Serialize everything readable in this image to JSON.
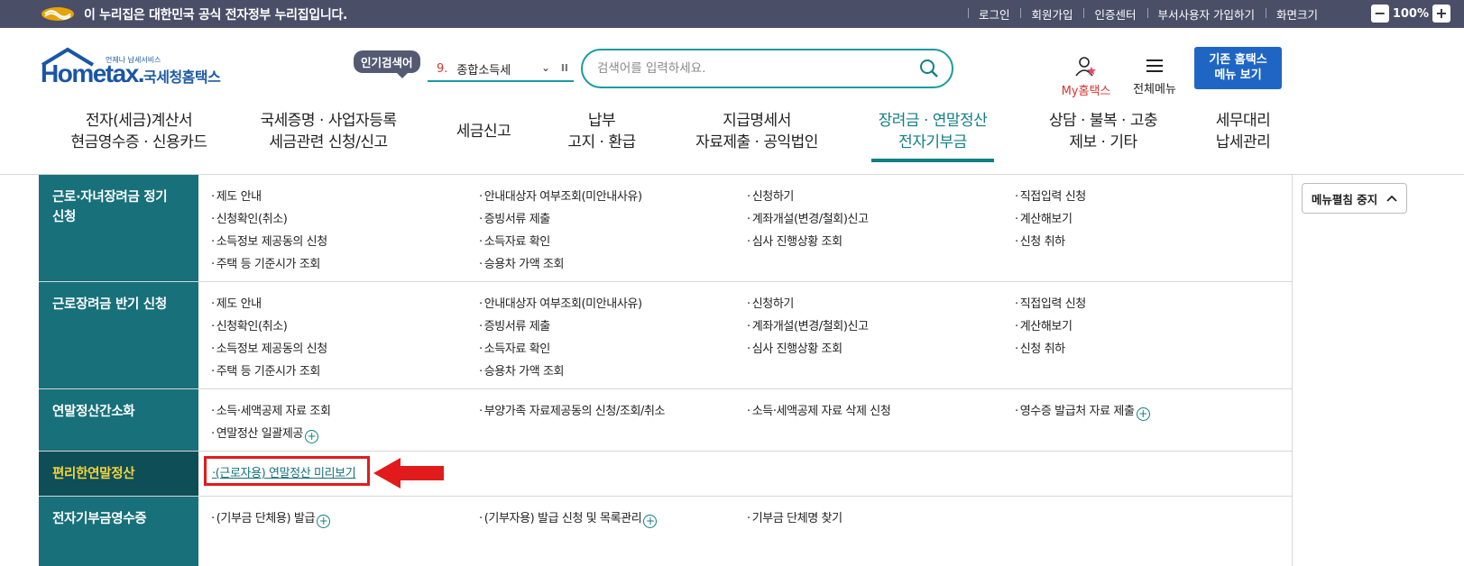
{
  "gov_bar": {
    "text": "이 누리집은 대한민국 공식 전자정부 누리집입니다.",
    "util_links": [
      "로그인",
      "회원가입",
      "인증센터",
      "부서사용자 가입하기",
      "화면크기"
    ],
    "zoom_minus": "−",
    "zoom_level": "100%",
    "zoom_plus": "+"
  },
  "header": {
    "logo_sub": "언제나 납세서비스",
    "logo_text": "Hometax.",
    "logo_kor": "국세청홈택스",
    "popular_label": "인기검색어",
    "popular_rank": "9.",
    "popular_term": "종합소득세",
    "search_placeholder": "검색어를 입력하세요.",
    "my_hometax": "My홈택스",
    "all_menu": "전체메뉴",
    "old_hometax_line1": "기존 홈택스",
    "old_hometax_line2": "메뉴 보기"
  },
  "gnb": [
    {
      "line1": "전자(세금)계산서",
      "line2": "현금영수증 · 신용카드"
    },
    {
      "line1": "국세증명 · 사업자등록",
      "line2": "세금관련 신청/신고"
    },
    {
      "line1": "세금신고",
      "line2": ""
    },
    {
      "line1": "납부",
      "line2": "고지 · 환급"
    },
    {
      "line1": "지급명세서",
      "line2": "자료제출 · 공익법인"
    },
    {
      "line1": "장려금 · 연말정산",
      "line2": "전자기부금"
    },
    {
      "line1": "상담 · 불복 · 고충",
      "line2": "제보 · 기타"
    },
    {
      "line1": "세무대리",
      "line2": "납세관리"
    }
  ],
  "menu_fold": "메뉴펼침 중지",
  "sections": [
    {
      "category_line1": "근로·자녀장려금 정기",
      "category_line2": "신청",
      "links": [
        "제도 안내",
        "안내대상자 여부조회(미안내사유)",
        "신청하기",
        "직접입력 신청",
        "신청확인(취소)",
        "증빙서류 제출",
        "계좌개설(변경/철회)신고",
        "계산해보기",
        "소득정보 제공동의 신청",
        "소득자료 확인",
        "심사 진행상황 조회",
        "신청 취하",
        "주택 등 기준시가 조회",
        "승용차 가액 조회"
      ]
    },
    {
      "category_line1": "근로장려금 반기 신청",
      "category_line2": "",
      "links": [
        "제도 안내",
        "안내대상자 여부조회(미안내사유)",
        "신청하기",
        "직접입력 신청",
        "신청확인(취소)",
        "증빙서류 제출",
        "계좌개설(변경/철회)신고",
        "계산해보기",
        "소득정보 제공동의 신청",
        "소득자료 확인",
        "심사 진행상황 조회",
        "신청 취하",
        "주택 등 기준시가 조회",
        "승용차 가액 조회"
      ]
    },
    {
      "category_line1": "연말정산간소화",
      "category_line2": "",
      "links": [
        "소득·세액공제 자료 조회",
        "부양가족 자료제공동의 신청/조회/취소",
        "소득·세액공제 자료 삭제 신청",
        "영수증 발급처 자료 제출",
        "연말정산 일괄제공"
      ]
    },
    {
      "category_line1": "편리한연말정산",
      "category_line2": "",
      "links": [
        "(근로자용) 연말정산 미리보기"
      ]
    },
    {
      "category_line1": "전자기부금영수증",
      "category_line2": "",
      "links": [
        "(기부금 단체용) 발급",
        "(기부자용) 발급 신청 및 목록관리",
        "기부금 단체명 찾기"
      ]
    }
  ]
}
